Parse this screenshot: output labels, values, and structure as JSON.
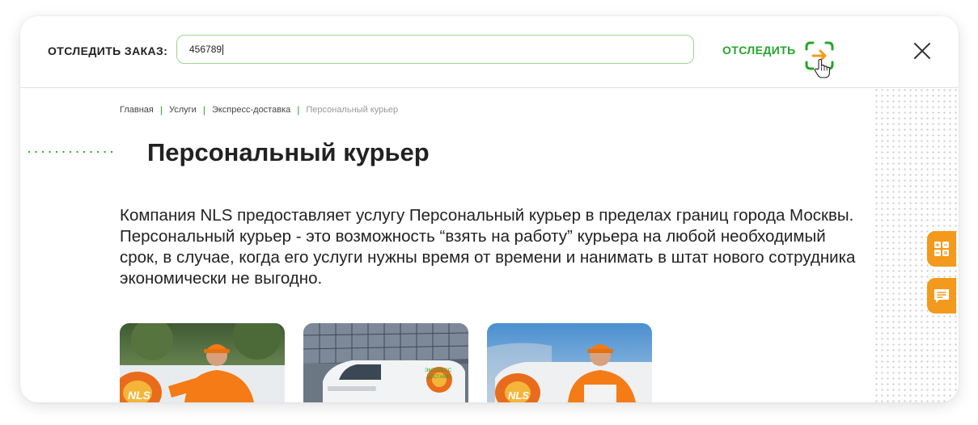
{
  "tracking": {
    "label": "ОТСЛЕДИТЬ ЗАКАЗ:",
    "input_value": "456789",
    "button_label": "ОТСЛЕДИТЬ"
  },
  "breadcrumb": {
    "items": [
      "Главная",
      "Услуги",
      "Экспресс-доставка"
    ],
    "current": "Персональный курьер"
  },
  "page": {
    "title": "Персональный курьер",
    "intro": "Компания NLS предоставляет услугу Персональный курьер в пределах границ города Москвы. Персональный курьер - это возможность “взять на работу” курьера на любой необходимый срок, в случае, когда его услуги нужны время от времени и нанимать в штат нового сотрудника экономически не выгодно."
  },
  "photos": {
    "van_logo_text": "NLS",
    "van_side_text": [
      "ЭКСПРЕСС",
      "ДОСТАВКА"
    ]
  },
  "icons": {
    "track_arrow": "arrow-right-icon",
    "close": "close-icon",
    "calculator": "calculator-icon",
    "feedback": "chat-icon",
    "cursor": "hand-cursor-icon"
  },
  "colors": {
    "accent_green": "#26a52d",
    "accent_orange": "#f39a1c",
    "input_border": "#9ed68f"
  }
}
